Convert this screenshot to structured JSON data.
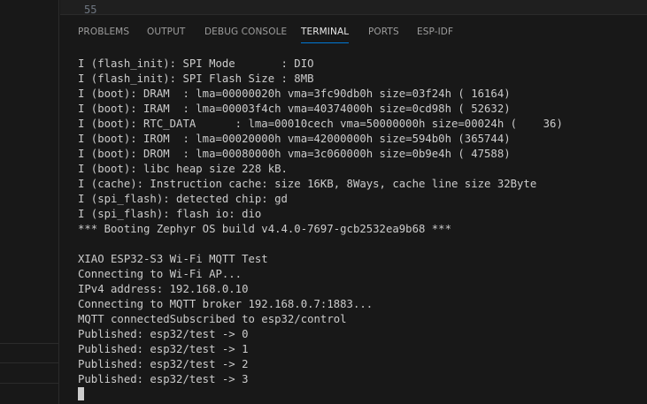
{
  "editor": {
    "line_number": "55"
  },
  "panel": {
    "tabs": [
      {
        "label": "PROBLEMS",
        "active": false
      },
      {
        "label": "OUTPUT",
        "active": false
      },
      {
        "label": "DEBUG CONSOLE",
        "active": false
      },
      {
        "label": "TERMINAL",
        "active": true
      },
      {
        "label": "PORTS",
        "active": false
      },
      {
        "label": "ESP-IDF",
        "active": false
      }
    ]
  },
  "terminal": {
    "lines": [
      "I (flash_init): SPI Mode       : DIO",
      "I (flash_init): SPI Flash Size : 8MB",
      "I (boot): DRAM  : lma=00000020h vma=3fc90db0h size=03f24h ( 16164)",
      "I (boot): IRAM  : lma=00003f4ch vma=40374000h size=0cd98h ( 52632)",
      "I (boot): RTC_DATA      : lma=00010cech vma=50000000h size=00024h (    36)",
      "I (boot): IROM  : lma=00020000h vma=42000000h size=594b0h (365744)",
      "I (boot): DROM  : lma=00080000h vma=3c060000h size=0b9e4h ( 47588)",
      "I (boot): libc heap size 228 kB.",
      "I (cache): Instruction cache: size 16KB, 8Ways, cache line size 32Byte",
      "I (spi_flash): detected chip: gd",
      "I (spi_flash): flash io: dio",
      "*** Booting Zephyr OS build v4.4.0-7697-gcb2532ea9b68 ***",
      "",
      "XIAO ESP32-S3 Wi-Fi MQTT Test",
      "Connecting to Wi-Fi AP...",
      "IPv4 address: 192.168.0.10",
      "Connecting to MQTT broker 192.168.0.7:1883...",
      "MQTT connectedSubscribed to esp32/control",
      "Published: esp32/test -> 0",
      "Published: esp32/test -> 1",
      "Published: esp32/test -> 2",
      "Published: esp32/test -> 3"
    ]
  },
  "colors": {
    "background": "#181818",
    "text": "#cccccc",
    "tab_inactive": "#9d9d9d",
    "tab_active": "#e7e7e7",
    "accent": "#0078d4"
  }
}
